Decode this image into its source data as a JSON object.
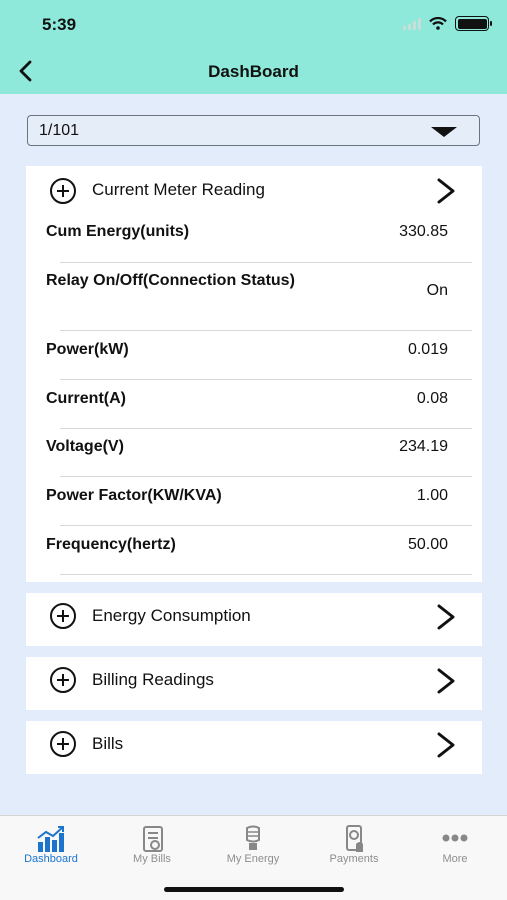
{
  "status_bar": {
    "time": "5:39"
  },
  "nav": {
    "title": "DashBoard"
  },
  "meter_select": {
    "value": "1/101"
  },
  "current_reading": {
    "title": "Current Meter Reading",
    "rows": [
      {
        "label": "Cum Energy(units)",
        "value": "330.85"
      },
      {
        "label": "Relay On/Off(Connection Status)",
        "value": "On"
      },
      {
        "label": "Power(kW)",
        "value": "0.019"
      },
      {
        "label": "Current(A)",
        "value": "0.08"
      },
      {
        "label": "Voltage(V)",
        "value": "234.19"
      },
      {
        "label": "Power Factor(KW/KVA)",
        "value": "1.00"
      },
      {
        "label": "Frequency(hertz)",
        "value": "50.00"
      }
    ]
  },
  "sections": [
    {
      "title": "Energy Consumption"
    },
    {
      "title": "Billing Readings"
    },
    {
      "title": "Bills"
    }
  ],
  "tabs": [
    {
      "label": "Dashboard",
      "icon": "chart-icon"
    },
    {
      "label": "My Bills",
      "icon": "bill-icon"
    },
    {
      "label": "My Energy",
      "icon": "bulb-icon"
    },
    {
      "label": "Payments",
      "icon": "payment-icon"
    },
    {
      "label": "More",
      "icon": "more-icon"
    }
  ],
  "colors": {
    "header": "#8ee9da",
    "background": "#e2ecfa",
    "active_tab": "#1c74cc"
  }
}
